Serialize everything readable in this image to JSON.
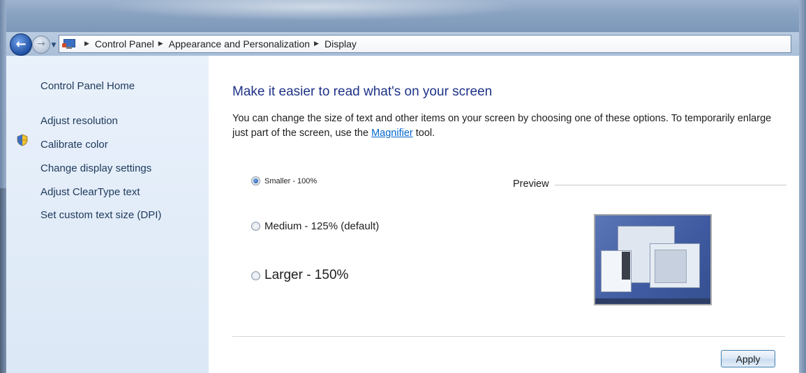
{
  "breadcrumb": [
    "Control Panel",
    "Appearance and Personalization",
    "Display"
  ],
  "nav": {
    "back_icon": "back-arrow-icon",
    "forward_icon": "forward-arrow-icon",
    "history_icon": "chevron-down-icon",
    "sep_glyph": "▶"
  },
  "sidebar": {
    "home": "Control Panel Home",
    "items": [
      {
        "label": "Adjust resolution"
      },
      {
        "label": "Calibrate color",
        "icon": "shield-icon"
      },
      {
        "label": "Change display settings"
      },
      {
        "label": "Adjust ClearType text"
      },
      {
        "label": "Set custom text size (DPI)"
      }
    ]
  },
  "main": {
    "heading": "Make it easier to read what's on your screen",
    "desc_part1": "You can change the size of text and other items on your screen by choosing one of these options. To temporarily enlarge just part of the screen, use the ",
    "desc_link": "Magnifier",
    "desc_part2": " tool.",
    "options": [
      {
        "label": "Smaller - 100%",
        "selected": true
      },
      {
        "label": "Medium - 125% (default)",
        "selected": false
      },
      {
        "label": "Larger - 150%",
        "selected": false
      }
    ],
    "preview_label": "Preview",
    "apply_label": "Apply"
  },
  "colors": {
    "heading": "#1e3287",
    "link": "#0066cc",
    "sidebar_bg": "#e3edf9"
  }
}
